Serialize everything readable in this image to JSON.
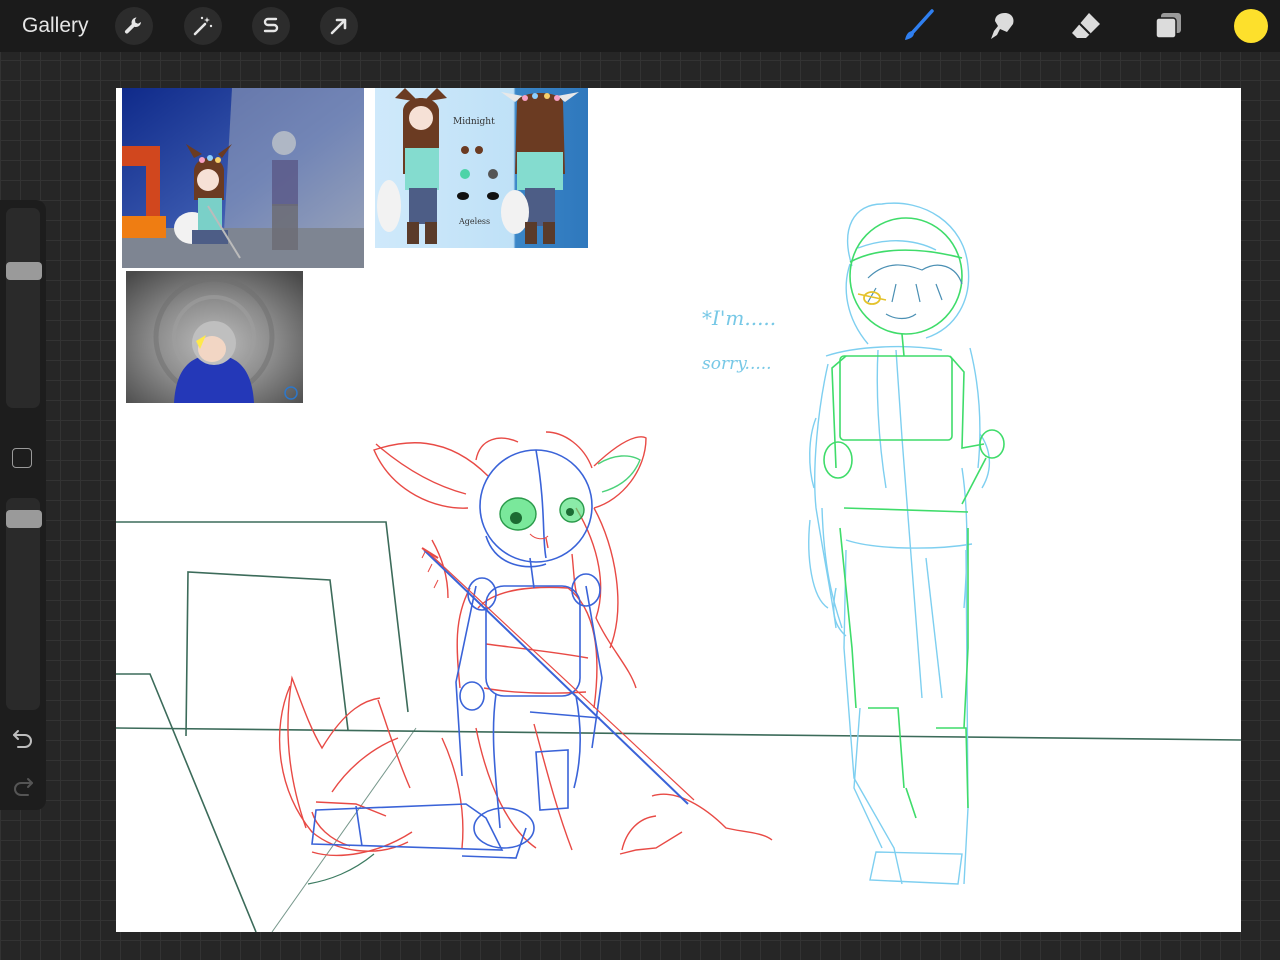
{
  "topbar": {
    "gallery_label": "Gallery",
    "actions": [
      {
        "icon": "wrench-icon"
      },
      {
        "icon": "magic-wand-icon"
      },
      {
        "icon": "selection-s-icon"
      },
      {
        "icon": "transform-arrow-icon"
      }
    ],
    "tools": [
      {
        "icon": "brush-icon",
        "active": true
      },
      {
        "icon": "smudge-icon",
        "active": false
      },
      {
        "icon": "eraser-icon",
        "active": false
      },
      {
        "icon": "layers-icon",
        "active": false
      }
    ],
    "current_color": "#fde02c",
    "active_tool_color": "#2f7ff0"
  },
  "sidebar": {
    "brush_size_slider": "brush-size",
    "opacity_slider": "opacity",
    "modify_button": "modify",
    "undo_icon": "undo-icon",
    "redo_icon": "redo-icon"
  },
  "canvas": {
    "reference_images": [
      {
        "name": "reference-room-scene"
      },
      {
        "name": "reference-midnight-ref-sheet",
        "title": "Midnight",
        "caption": "Ageless"
      },
      {
        "name": "reference-hooded-figure"
      }
    ],
    "dialogue_line_1": "*I'm.....",
    "dialogue_line_2": "sorry.....",
    "sketch_colors": {
      "fox_girl": "#e84a45",
      "fox_girl_construction": "#3a63d8",
      "hooded_boy_light": "#7ecff0",
      "hooded_boy_green": "#3fdc6a",
      "background_lines": "#3c6b5a"
    }
  }
}
